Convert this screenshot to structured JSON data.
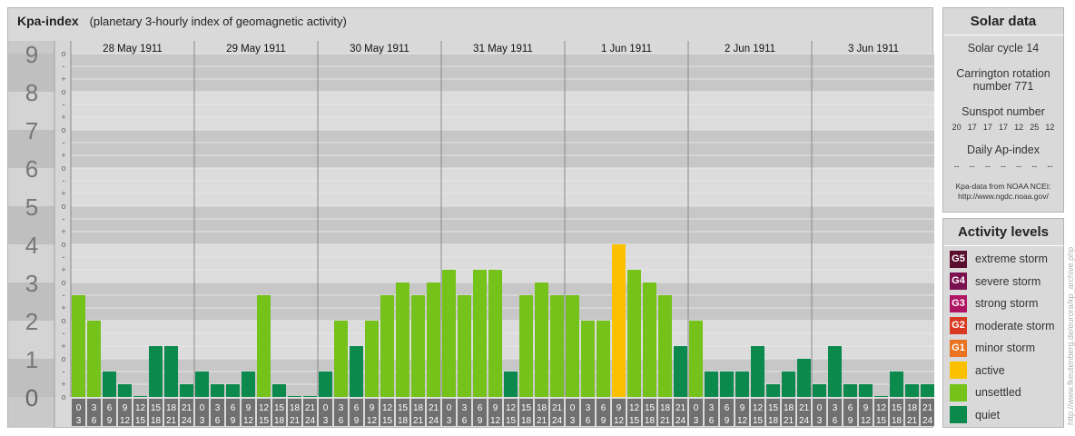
{
  "header": {
    "title": "Kpa-index",
    "subtitle": "(planetary 3-hourly index of geomagnetic activity)"
  },
  "chart_data": {
    "type": "bar",
    "y_range": [
      0,
      9
    ],
    "y_tick_labels": [
      "0",
      "1",
      "2",
      "3",
      "4",
      "5",
      "6",
      "7",
      "8",
      "9"
    ],
    "sub_tick_labels": [
      "o",
      "+",
      "-"
    ],
    "days": [
      "28 May 1911",
      "29 May 1911",
      "30 May 1911",
      "31 May 1911",
      "1 Jun 1911",
      "2 Jun 1911",
      "3 Jun 1911"
    ],
    "interval_starts": [
      "0",
      "3",
      "6",
      "9",
      "12",
      "15",
      "18",
      "21"
    ],
    "interval_ends": [
      "3",
      "6",
      "9",
      "12",
      "15",
      "18",
      "21",
      "24"
    ],
    "values": [
      [
        2.667,
        2.0,
        0.667,
        0.333,
        0.0,
        1.333,
        1.333,
        0.333
      ],
      [
        0.667,
        0.333,
        0.333,
        0.667,
        2.667,
        0.333,
        0.0,
        0.0
      ],
      [
        0.667,
        2.0,
        1.333,
        2.0,
        2.667,
        3.0,
        2.667,
        3.0
      ],
      [
        3.333,
        2.667,
        3.333,
        3.333,
        0.667,
        2.667,
        3.0,
        2.667
      ],
      [
        2.667,
        2.0,
        2.0,
        4.0,
        3.333,
        3.0,
        2.667,
        1.333
      ],
      [
        2.0,
        0.667,
        0.667,
        0.667,
        1.333,
        0.333,
        0.667,
        1.0
      ],
      [
        0.333,
        1.333,
        0.333,
        0.333,
        0.0,
        0.667,
        0.333,
        0.333
      ]
    ],
    "color_levels": {
      "quiet": "#0c8a4e",
      "unsettled": "#75c21a",
      "active": "#fbc100"
    },
    "grid": true
  },
  "solar": {
    "title": "Solar data",
    "cycle": "Solar cycle 14",
    "carrington": "Carrington rotation number 771",
    "sunspot_label": "Sunspot number",
    "sunspot_values": [
      "20",
      "17",
      "17",
      "17",
      "12",
      "25",
      "12"
    ],
    "ap_label": "Daily Ap-index",
    "ap_values": [
      "--",
      "--",
      "--",
      "--",
      "--",
      "--",
      "--"
    ],
    "credit_line1": "Kpa-data from NOAA NCEI:",
    "credit_line2": "http://www.ngdc.noaa.gov/"
  },
  "activity": {
    "title": "Activity levels",
    "levels": [
      {
        "code": "G5",
        "label": "extreme storm",
        "color": "#5a0f2e"
      },
      {
        "code": "G4",
        "label": "severe storm",
        "color": "#7a1250"
      },
      {
        "code": "G3",
        "label": "strong storm",
        "color": "#b01563"
      },
      {
        "code": "G2",
        "label": "moderate storm",
        "color": "#db3a22"
      },
      {
        "code": "G1",
        "label": "minor storm",
        "color": "#e9731e"
      },
      {
        "code": "",
        "label": "active",
        "color": "#fbc100"
      },
      {
        "code": "",
        "label": "unsettled",
        "color": "#75c21a"
      },
      {
        "code": "",
        "label": "quiet",
        "color": "#0c8a4e"
      }
    ]
  },
  "watermark": "http://www.fkeutenberg.de/eurora/kp_archive.php"
}
